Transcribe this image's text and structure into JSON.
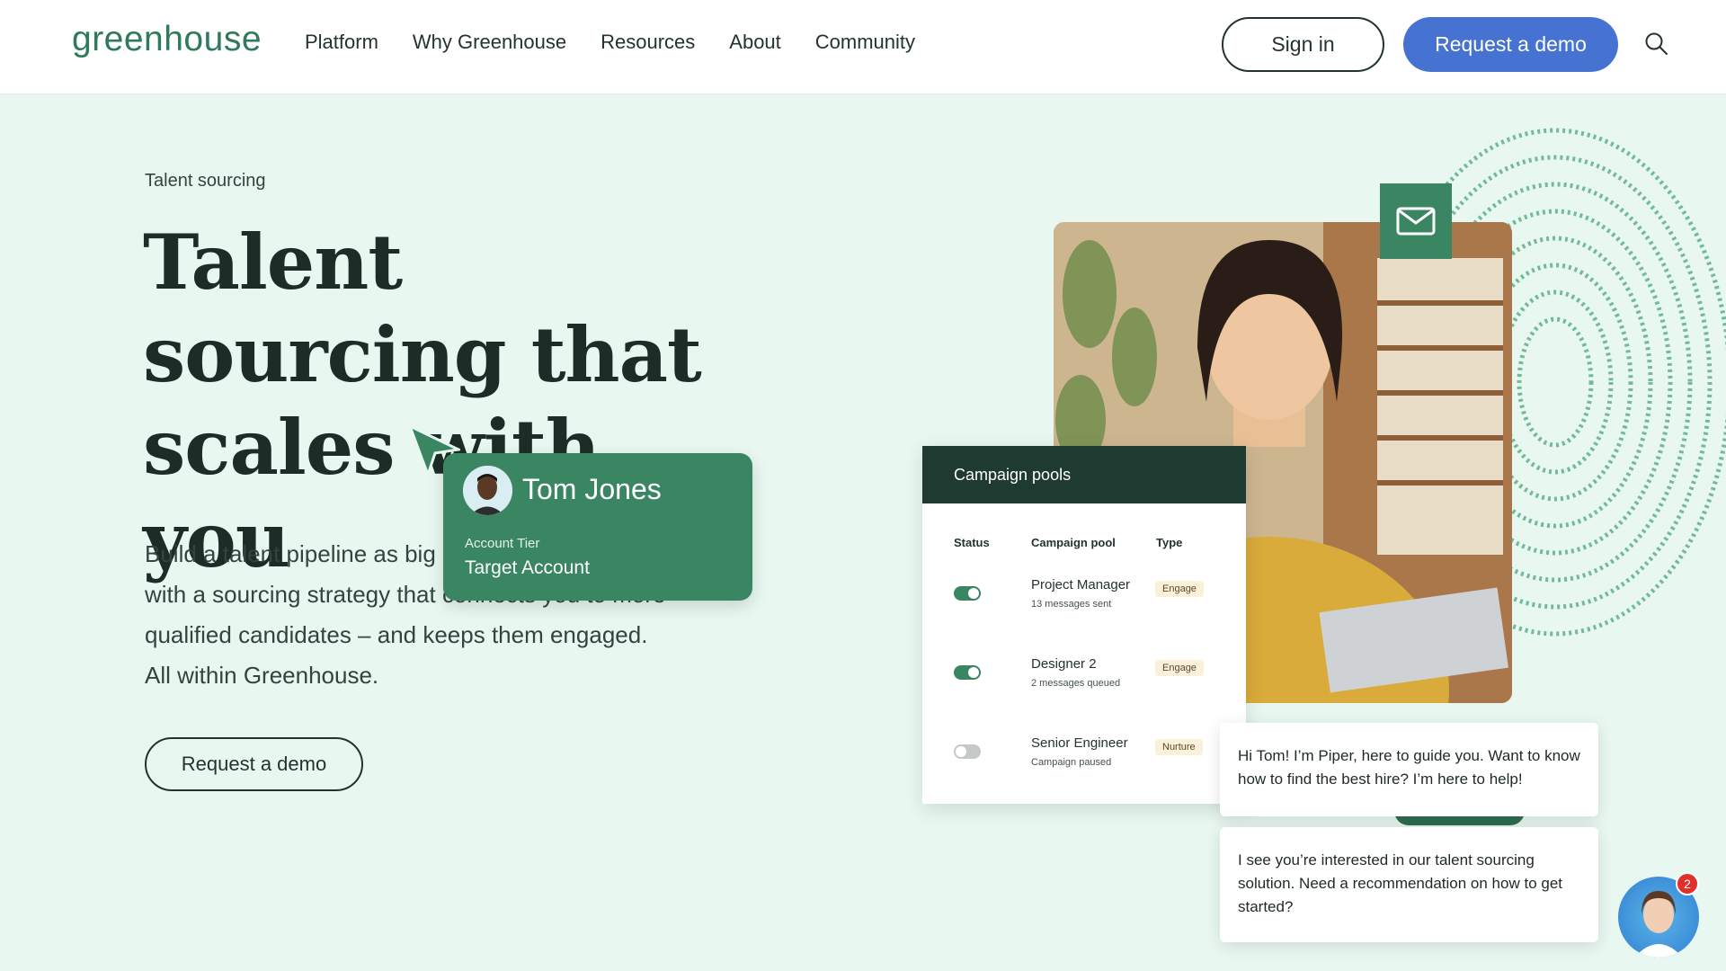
{
  "header": {
    "logo": "greenhouse",
    "nav": [
      "Platform",
      "Why Greenhouse",
      "Resources",
      "About",
      "Community"
    ],
    "signin_label": "Sign in",
    "demo_label": "Request a demo"
  },
  "hero": {
    "eyebrow": "Talent sourcing",
    "title": "Talent sourcing that scales with you",
    "body": "Build a talent pipeline as big as your ambitions with a sourcing strategy that connects you to more qualified candidates – and keeps them engaged. All within Greenhouse.",
    "cta_label": "Request a demo"
  },
  "tom_card": {
    "name": "Tom Jones",
    "tier_label": "Account Tier",
    "tier_value": "Target Account"
  },
  "campaign": {
    "title": "Campaign pools",
    "columns": [
      "Status",
      "Campaign pool",
      "Type"
    ],
    "rows": [
      {
        "name": "Project Manager",
        "sub": "13 messages sent",
        "type": "Engage",
        "active": true
      },
      {
        "name": "Designer 2",
        "sub": "2 messages queued",
        "type": "Engage",
        "active": true
      },
      {
        "name": "Senior Engineer",
        "sub": "Campaign paused",
        "type": "Nurture",
        "active": false
      }
    ]
  },
  "chat": {
    "message1": "Hi Tom! I’m Piper, here to guide you. Want to know how to find the best hire? I’m here to help!",
    "message2": "I see you’re interested in our talent sourcing solution. Need a recommendation on how to get started?",
    "badge_count": "2"
  },
  "colors": {
    "brand_green": "#3a8562",
    "dark_green": "#1f3a31",
    "primary_blue": "#4673d1",
    "background": "#e8f8f1"
  },
  "icons": [
    "search-icon",
    "mail-icon",
    "cursor-arrow-icon"
  ]
}
